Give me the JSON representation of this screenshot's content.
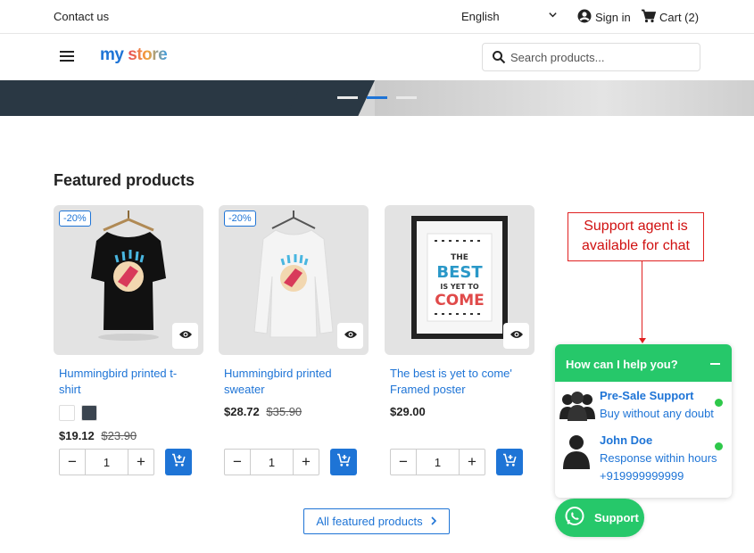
{
  "topbar": {
    "contact": "Contact us",
    "language": "English",
    "signin": "Sign in",
    "cart": "Cart (2)"
  },
  "header": {
    "logo_my": "my",
    "logo_store": "store",
    "search_placeholder": "Search products..."
  },
  "hero": {
    "slides": 3,
    "active_slide": 2
  },
  "featured": {
    "title": "Featured products",
    "products": [
      {
        "name": "Hummingbird printed t-shirt",
        "badge": "-20%",
        "price": "$19.12",
        "old_price": "$23.90",
        "qty": "1",
        "swatches": [
          "#ffffff",
          "#3b4550"
        ]
      },
      {
        "name": "Hummingbird printed sweater",
        "badge": "-20%",
        "price": "$28.72",
        "old_price": "$35.90",
        "qty": "1"
      },
      {
        "name": "The best is yet to come' Framed poster",
        "price": "$29.00",
        "qty": "1",
        "poster": {
          "line1": "THE",
          "line2": "BEST",
          "line3": "IS YET TO",
          "line4": "COME"
        }
      }
    ],
    "all_button": "All featured products"
  },
  "annotation": {
    "text": "Support agent is available for chat"
  },
  "chat": {
    "header": "How can I help you?",
    "agents": [
      {
        "name": "Pre-Sale Support",
        "status": "Buy without any doubt"
      },
      {
        "name": "John Doe",
        "status": "Response within hours",
        "phone": "+919999999999"
      }
    ],
    "support_button": "Support"
  },
  "colors": {
    "accent": "#1e74d6",
    "whatsapp": "#26c86a",
    "annotation": "#e02020"
  }
}
